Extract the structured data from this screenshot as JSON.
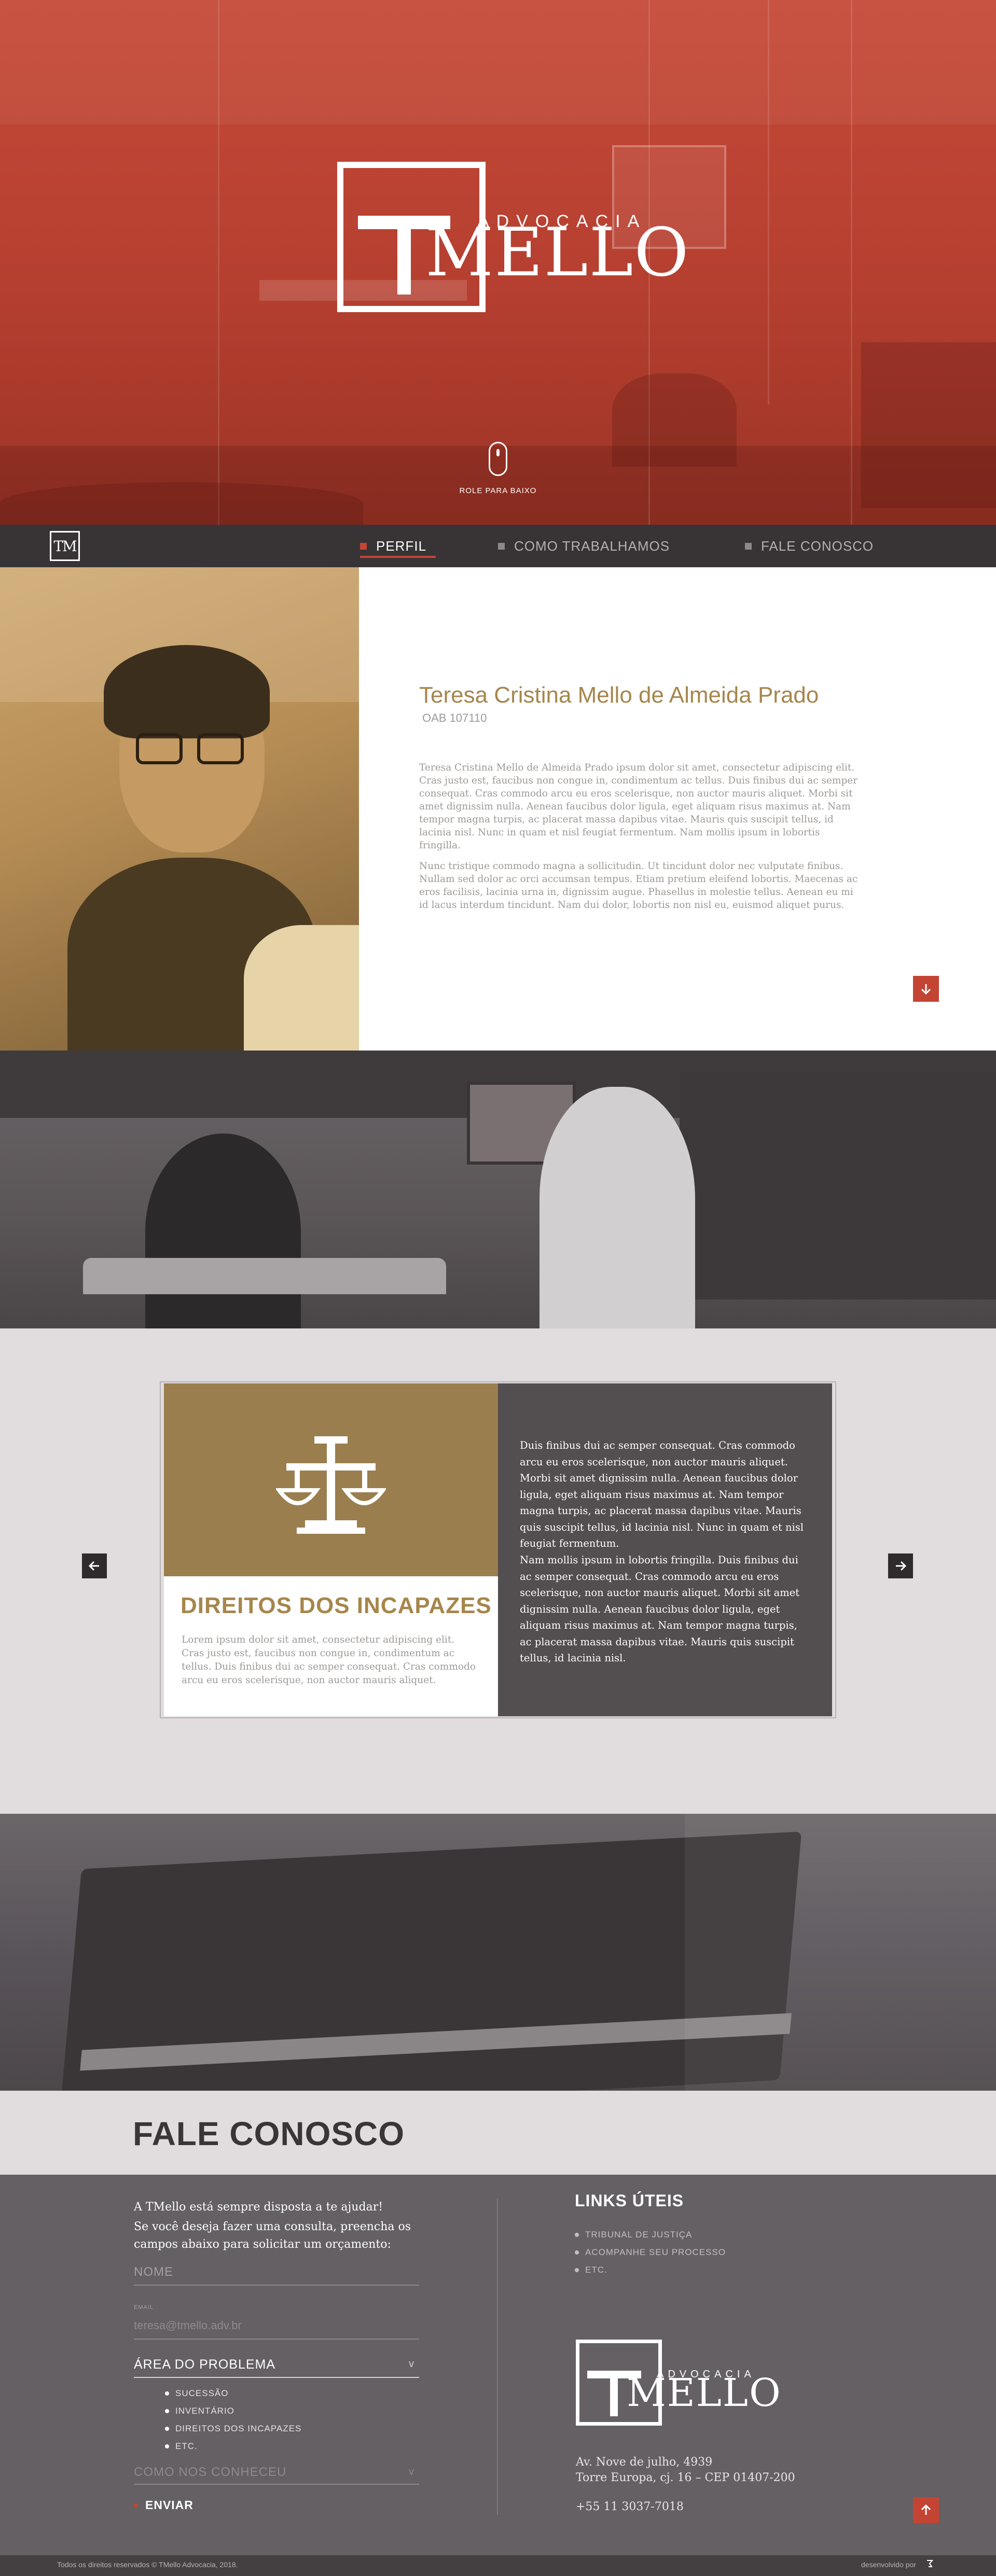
{
  "hero": {
    "logo": {
      "mark": "T",
      "name": "MELLO",
      "subtitle": "ADVOCACIA"
    },
    "scroll_hint": "ROLE PARA BAIXO"
  },
  "nav": {
    "logo_mark": "TM",
    "items": [
      {
        "label": "PERFIL",
        "active": true
      },
      {
        "label": "COMO TRABALHAMOS",
        "active": false
      },
      {
        "label": "FALE CONOSCO",
        "active": false
      }
    ]
  },
  "profile": {
    "name": "Teresa Cristina Mello de Almeida Prado",
    "oab": "OAB 107110",
    "paragraphs": [
      "Teresa Cristina Mello de Almeida Prado ipsum dolor sit amet, consectetur adipiscing elit. Cras justo est, faucibus non congue in, condimentum ac tellus. Duis finibus dui ac semper consequat. Cras commodo arcu eu eros scelerisque, non auctor mauris aliquet. Morbi sit amet dignissim nulla. Aenean faucibus dolor ligula, eget aliquam risus maximus at. Nam tempor magna turpis, ac placerat massa dapibus vitae. Mauris quis suscipit tellus, id lacinia nisl. Nunc in quam et nisl feugiat fermentum. Nam mollis ipsum in lobortis fringilla.",
      "Nunc tristique commodo magna a sollicitudin. Ut tincidunt dolor nec vulputate finibus. Nullam sed dolor ac orci accumsan tempus. Etiam pretium eleifend lobortis. Maecenas ac eros facilisis, lacinia urna in, dignissim augue. Phasellus in molestie tellus. Aenean eu mi id lacus interdum tincidunt. Nam dui dolor, lobortis non nisl eu, euismod aliquet purus."
    ],
    "down_icon": "arrow-down-icon"
  },
  "services": {
    "card": {
      "icon": "scales-of-justice-icon",
      "title": "DIREITOS DOS INCAPAZES",
      "text": "Lorem ipsum dolor sit amet, consectetur adipiscing elit. Cras justo est, faucibus non congue in, condimentum ac tellus. Duis finibus dui ac semper consequat. Cras commodo arcu eu eros scelerisque, non auctor mauris aliquet.",
      "detail_paragraphs": [
        "Duis finibus dui ac semper consequat. Cras commodo arcu eu eros scelerisque, non auctor mauris aliquet. Morbi sit amet dignissim nulla. Aenean faucibus dolor ligula, eget aliquam risus maximus at. Nam tempor magna turpis, ac placerat massa dapibus vitae. Mauris quis suscipit tellus, id lacinia nisl. Nunc in quam et nisl feugiat fermentum.",
        "Nam mollis ipsum in lobortis fringilla. Duis finibus dui ac semper consequat. Cras commodo arcu eu eros scelerisque, non auctor mauris aliquet. Morbi sit amet dignissim nulla. Aenean faucibus dolor ligula, eget aliquam risus maximus at. Nam tempor magna turpis, ac placerat massa dapibus vitae. Mauris quis suscipit tellus, id lacinia nisl."
      ]
    },
    "prev_icon": "arrow-left-icon",
    "next_icon": "arrow-right-icon"
  },
  "contact": {
    "title": "FALE CONOSCO",
    "intro_1": "A TMello está sempre disposta a te ajudar!",
    "intro_2": "Se você deseja fazer uma consulta, preencha os campos abaixo para solicitar um orçamento:",
    "form": {
      "name_placeholder": "NOME",
      "email_label": "EMAIL",
      "email_value": "teresa@tmello.adv.br",
      "area_label": "ÁREA DO PROBLEMA",
      "area_options": [
        "SUCESSÃO",
        "INVENTÁRIO",
        "DIREITOS DOS INCAPAZES",
        "ETC."
      ],
      "source_label": "COMO NOS CONHECEU",
      "send_label": "ENVIAR",
      "chevron": "v"
    },
    "links_title": "LINKS ÚTEIS",
    "links": [
      "TRIBUNAL DE JUSTIÇA",
      "ACOMPANHE SEU PROCESSO",
      "ETC."
    ],
    "logo": {
      "mark": "T",
      "name": "MELLO",
      "subtitle": "ADVOCACIA"
    },
    "address_1": "Av. Nove de julho, 4939",
    "address_2": "Torre Europa, cj. 16 – CEP 01407-200",
    "phone": "+55 11 3037-7018",
    "up_icon": "arrow-up-icon"
  },
  "footer": {
    "copyright": "Todos os direitos reservados © TMello Advocacia, 2018.",
    "developer_label": "desenvolvido por",
    "developer_icon": "developer-mark-icon"
  },
  "colors": {
    "brand_red": "#c44433",
    "gold": "#a6864c",
    "dark": "#383436",
    "panel_gray": "#646063"
  }
}
